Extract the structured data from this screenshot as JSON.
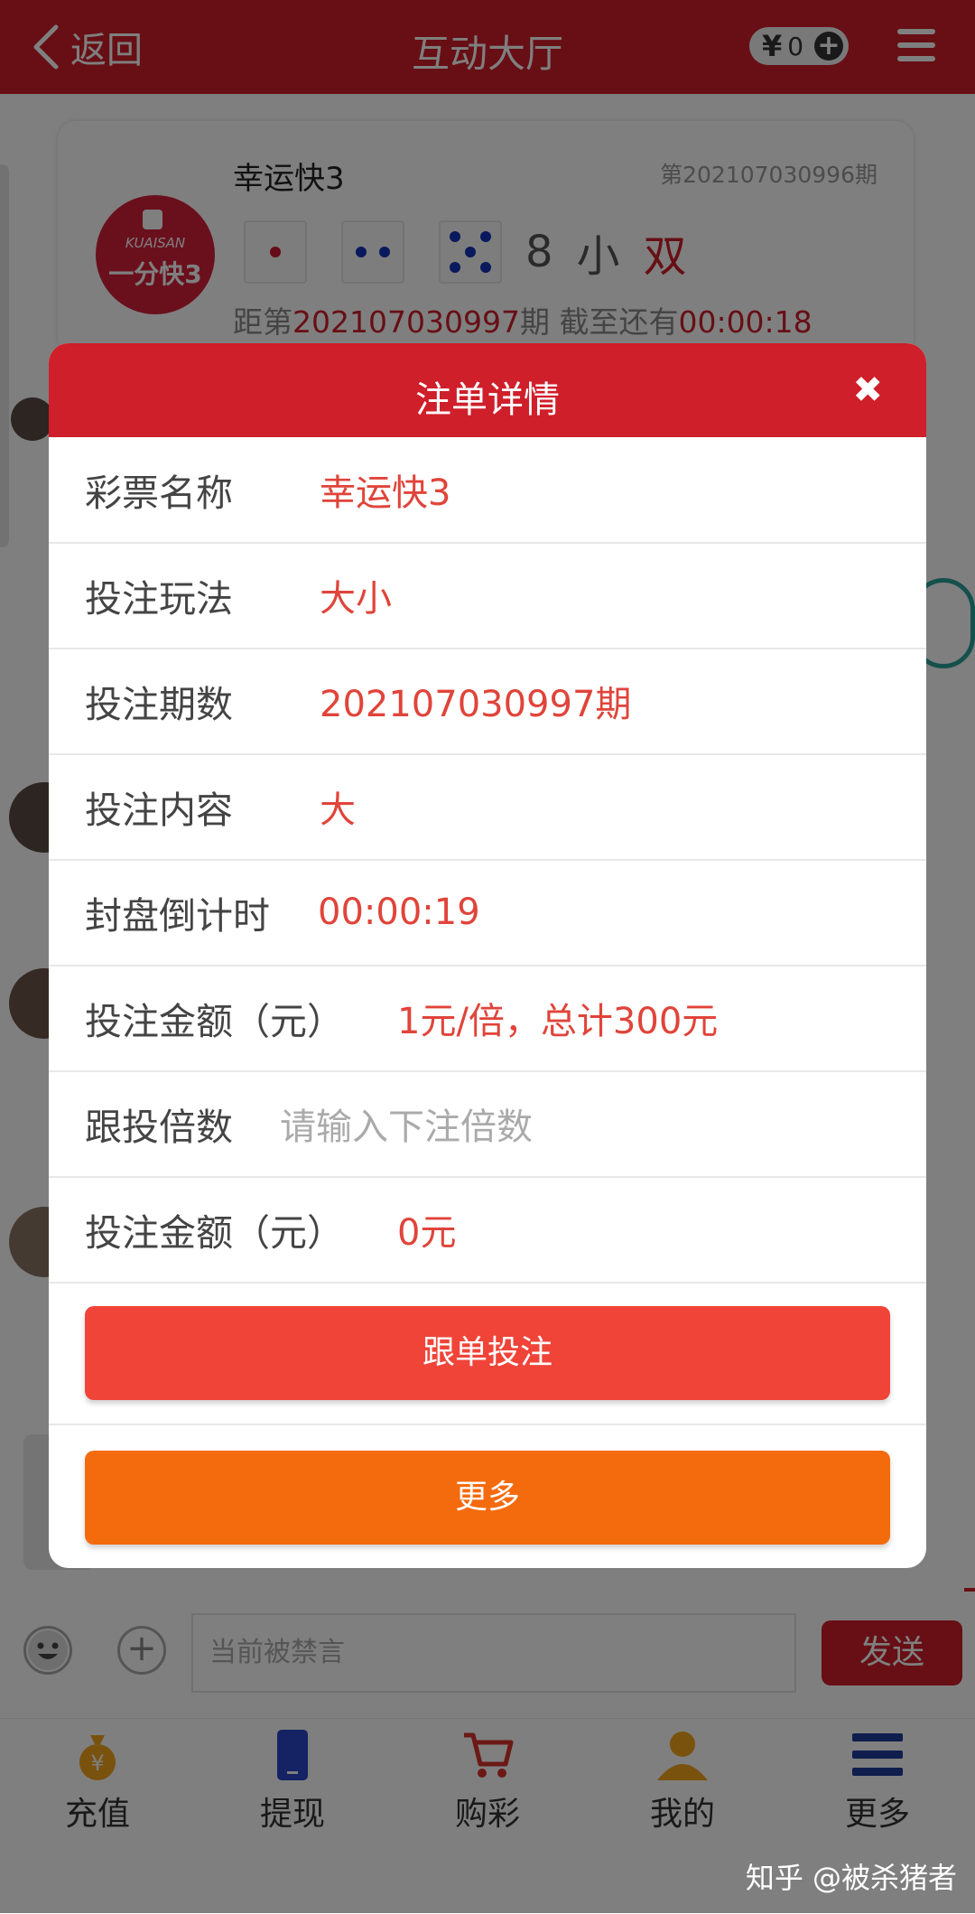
{
  "header": {
    "back_label": "返回",
    "title": "互动大厅",
    "balance_symbol": "¥",
    "balance": "0"
  },
  "lottery_card": {
    "logo_en": "KUAISAN",
    "logo_cn": "一分快3",
    "name": "幸运快3",
    "last_issue": "第202107030996期",
    "dice": [
      1,
      2,
      5
    ],
    "sum": "8",
    "size": "小",
    "parity": "双",
    "next_prefix": "距第",
    "next_issue": "202107030997",
    "next_suffix": "期 截至还有",
    "next_countdown": "00:00:18"
  },
  "modal": {
    "title": "注单详情",
    "rows": [
      {
        "label": "彩票名称",
        "value": "幸运快3"
      },
      {
        "label": "投注玩法",
        "value": "大小"
      },
      {
        "label": "投注期数",
        "value": "202107030997期"
      },
      {
        "label": "投注内容",
        "value": "大"
      },
      {
        "label": "封盘倒计时",
        "value": "00:00:19"
      },
      {
        "label": "投注金额（元）",
        "value": "1元/倍，总计300元"
      },
      {
        "label": "跟投倍数",
        "placeholder": "请输入下注倍数"
      },
      {
        "label": "投注金额（元）",
        "value": "0元"
      }
    ],
    "follow_button": "跟单投注",
    "more_button": "更多"
  },
  "input_bar": {
    "placeholder": "当前被禁言",
    "send_label": "发送"
  },
  "bottom_nav": [
    {
      "label": "充值",
      "icon": "money-bag-icon"
    },
    {
      "label": "提现",
      "icon": "phone-icon"
    },
    {
      "label": "购彩",
      "icon": "cart-icon"
    },
    {
      "label": "我的",
      "icon": "user-icon"
    },
    {
      "label": "更多",
      "icon": "menu-icon"
    }
  ],
  "watermark": "知乎 @被杀猪者",
  "colors": {
    "brand_red": "#cf1f2a",
    "value_red": "#e0443a",
    "follow_button": "#f04438",
    "more_button": "#f46b0e",
    "die_pip_red": "#cc1a2a",
    "die_pip_blue": "#1233b8"
  }
}
